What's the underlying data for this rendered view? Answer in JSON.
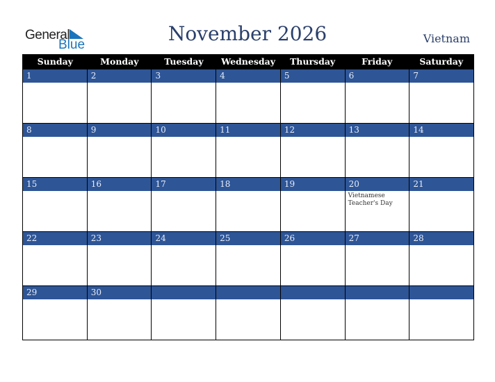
{
  "logo": {
    "line1": "General",
    "line2": "Blue",
    "icon": "triangle-logo-icon"
  },
  "title": "November 2026",
  "country": "Vietnam",
  "colors": {
    "header_bg": "#000000",
    "day_bar": "#2e5596",
    "title": "#2a3f6b",
    "logo_blue": "#1a75bc"
  },
  "weekdays": [
    "Sunday",
    "Monday",
    "Tuesday",
    "Wednesday",
    "Thursday",
    "Friday",
    "Saturday"
  ],
  "weeks": [
    [
      {
        "d": "1"
      },
      {
        "d": "2"
      },
      {
        "d": "3"
      },
      {
        "d": "4"
      },
      {
        "d": "5"
      },
      {
        "d": "6"
      },
      {
        "d": "7"
      }
    ],
    [
      {
        "d": "8"
      },
      {
        "d": "9"
      },
      {
        "d": "10"
      },
      {
        "d": "11"
      },
      {
        "d": "12"
      },
      {
        "d": "13"
      },
      {
        "d": "14"
      }
    ],
    [
      {
        "d": "15"
      },
      {
        "d": "16"
      },
      {
        "d": "17"
      },
      {
        "d": "18"
      },
      {
        "d": "19"
      },
      {
        "d": "20",
        "event": "Vietnamese Teacher's Day"
      },
      {
        "d": "21"
      }
    ],
    [
      {
        "d": "22"
      },
      {
        "d": "23"
      },
      {
        "d": "24"
      },
      {
        "d": "25"
      },
      {
        "d": "26"
      },
      {
        "d": "27"
      },
      {
        "d": "28"
      }
    ],
    [
      {
        "d": "29"
      },
      {
        "d": "30"
      },
      {
        "d": ""
      },
      {
        "d": ""
      },
      {
        "d": ""
      },
      {
        "d": ""
      },
      {
        "d": ""
      }
    ]
  ]
}
